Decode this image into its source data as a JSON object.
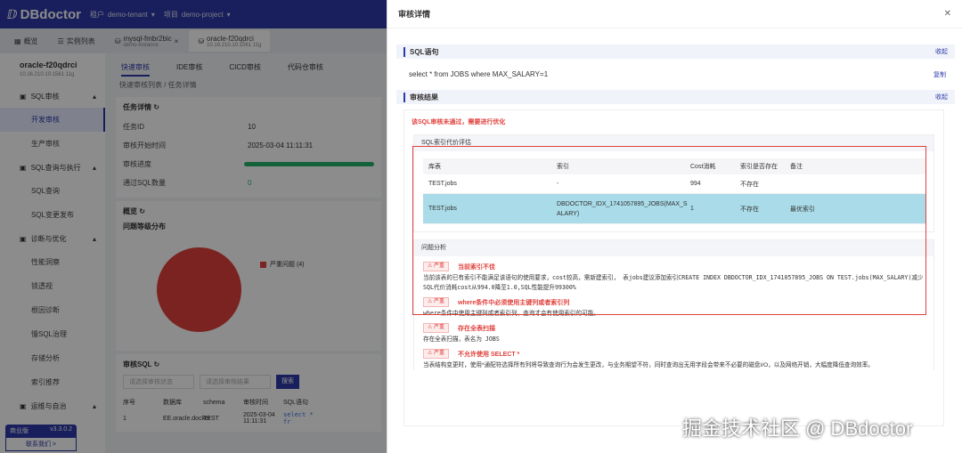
{
  "app": {
    "logo": "DBdoctor",
    "tenant_label": "租户",
    "tenant": "demo-tenant",
    "project_label": "项目",
    "project": "demo-project"
  },
  "tabs": [
    {
      "label": "概览"
    },
    {
      "label": "实例列表"
    },
    {
      "label": "mysql-fmbr2bic",
      "sub": "demo-instance"
    },
    {
      "label": "oracle-f20qdrci",
      "sub": "10.16.210.10:1561 11g"
    }
  ],
  "sidebar": {
    "db_name": "oracle-f20qdrci",
    "db_addr": "10.16.210.10:1561 11g",
    "items": [
      {
        "label": "SQL审核",
        "group": true
      },
      {
        "label": "开发审核"
      },
      {
        "label": "生产审核"
      },
      {
        "label": "SQL查询与执行",
        "group": true
      },
      {
        "label": "SQL查询"
      },
      {
        "label": "SQL变更发布"
      },
      {
        "label": "诊断与优化",
        "group": true
      },
      {
        "label": "性能洞察"
      },
      {
        "label": "锁透视"
      },
      {
        "label": "根因诊断"
      },
      {
        "label": "慢SQL治理"
      },
      {
        "label": "存储分析"
      },
      {
        "label": "索引推荐"
      },
      {
        "label": "运维与自治",
        "group": true
      }
    ],
    "edition": "商业版",
    "version": "v3.3.0.2",
    "contact": "联系我们 >"
  },
  "main": {
    "subtabs": [
      "快速审核",
      "IDE审核",
      "CICD审核",
      "代码仓审核"
    ],
    "breadcrumb": "快速审核列表 / 任务详情",
    "task_title": "任务详情",
    "task": [
      {
        "k": "任务ID",
        "v": "10"
      },
      {
        "k": "审核开始时间",
        "v": "2025-03-04 11:11:31"
      },
      {
        "k": "审核进度",
        "v": ""
      },
      {
        "k": "通过SQL数量",
        "v": "0"
      }
    ],
    "overview_title": "概览",
    "dist_title": "问题等级分布",
    "legend": "严重问题 (4)",
    "sql_title": "审核SQL",
    "filter1": "请选择审核状态",
    "filter2": "请选择审核结果",
    "search": "搜索",
    "cols": [
      "序号",
      "数据库",
      "schema",
      "审核时间",
      "SQL语句"
    ],
    "row": [
      "1",
      "EE.oracle.docker",
      "TEST",
      "2025-03-04 11:11:31",
      "select * fr"
    ]
  },
  "drawer": {
    "title": "审核详情",
    "close": "✕",
    "sql_section": "SQL语句",
    "fold": "收起",
    "sql": "select * from JOBS where MAX_SALARY=1",
    "copy": "复制",
    "result_section": "审核结果",
    "fail_msg": "该SQL审核未通过，需要进行优化",
    "cost_title": "SQL索引代价评估",
    "cost_cols": [
      "库表",
      "索引",
      "Cost消耗",
      "索引是否存在",
      "备注"
    ],
    "cost_rows": [
      {
        "table": "TEST.jobs",
        "index": "-",
        "cost": "994",
        "exists": "不存在",
        "note": ""
      },
      {
        "table": "TEST.jobs",
        "index": "DBDOCTOR_IDX_1741057895_JOBS(MAX_SALARY)",
        "cost": "1",
        "exists": "不存在",
        "note": "最优索引"
      }
    ],
    "issues_title": "问题分析",
    "issues": [
      {
        "level": "⚠ 严重",
        "title": "当前索引不佳",
        "desc": "当前该表的已有索引不能满足该语句的使用要求，cost较高，需新建索引， 表jobs建议添加索引CREATE INDEX DBDOCTOR_IDX_1741057895_JOBS ON TEST.jobs(MAX_SALARY)减少SQL代价消耗cost从994.0降至1.0,SQL性能提升99300%"
      },
      {
        "level": "⚠ 严重",
        "title": "where条件中必须使用主键列或者索引列",
        "desc": "where条件中使用主键列或者索引列，查询才会有使用索引的可能。"
      },
      {
        "level": "⚠ 严重",
        "title": "存在全表扫描",
        "desc": "存在全表扫描，表名为 JOBS"
      },
      {
        "level": "⚠ 严重",
        "title": "不允许使用 SELECT *",
        "desc": "当表结构变更时，使用*通配符选择所有列将导致查询行为会发生更改，与业务期望不符，同时查询出无用字段会带来不必要的磁盘I/O，以及网络开销，大幅度降低查询效率。"
      }
    ]
  },
  "watermark": "掘金技术社区 @ DBdoctor"
}
